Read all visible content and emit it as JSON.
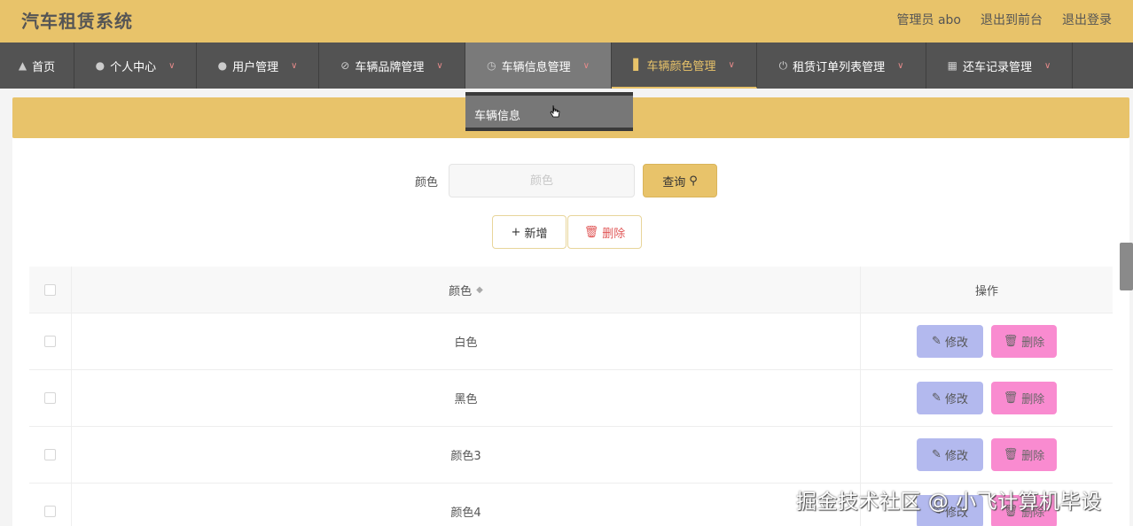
{
  "header": {
    "title": "汽车租赁系统",
    "admin_label": "管理员 abo",
    "to_front": "退出到前台",
    "logout": "退出登录"
  },
  "nav": {
    "items": [
      {
        "label": "首页",
        "icon": "home-icon"
      },
      {
        "label": "个人中心",
        "icon": "user-icon"
      },
      {
        "label": "用户管理",
        "icon": "user-icon"
      },
      {
        "label": "车辆品牌管理",
        "icon": "bell-off-icon"
      },
      {
        "label": "车辆信息管理",
        "icon": "clock-icon"
      },
      {
        "label": "车辆颜色管理",
        "icon": "bar-chart-icon"
      },
      {
        "label": "租赁订单列表管理",
        "icon": "power-icon"
      },
      {
        "label": "还车记录管理",
        "icon": "grid-icon"
      }
    ],
    "dropdown_item": "车辆信息"
  },
  "search": {
    "label": "颜色",
    "placeholder": "颜色",
    "button": "查询"
  },
  "actions": {
    "add": "新增",
    "delete": "删除"
  },
  "table": {
    "headers": {
      "color": "颜色",
      "ops": "操作"
    },
    "rows": [
      {
        "color": "白色",
        "edit": "修改",
        "delete": "删除"
      },
      {
        "color": "黑色",
        "edit": "修改",
        "delete": "删除"
      },
      {
        "color": "颜色3",
        "edit": "修改",
        "delete": "删除"
      },
      {
        "color": "颜色4",
        "edit": "修改",
        "delete": "删除"
      }
    ]
  },
  "watermark": "掘金技术社区 @ 小飞计算机毕设",
  "colors": {
    "accent": "#e8c36a",
    "nav_bg": "#535353",
    "edit_btn": "#b3b9ee",
    "delete_btn": "#f98bd0"
  }
}
